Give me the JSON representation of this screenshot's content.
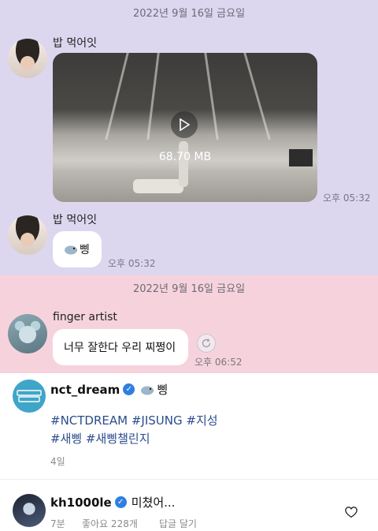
{
  "chat": {
    "date_header_1": "2022년 9월 16일 금요일",
    "msg1": {
      "sender": "밥 먹어잇",
      "video_size": "68.70 MB",
      "time": "오후 05:32"
    },
    "msg2": {
      "sender": "밥 먹어잇",
      "text": "삥",
      "time": "오후 05:32"
    },
    "date_header_2": "2022년 9월 16일 금요일",
    "msg3": {
      "sender": "finger artist",
      "text": "너무 잘한다 우리 찌쩡이",
      "time": "오후 06:52"
    }
  },
  "post_caption": {
    "username": "nct_dream",
    "text": "삥",
    "hashtags_line1": "#NCTDREAM #JISUNG #지성",
    "hashtags_line2": "#새삥 #새삥챌린지",
    "age": "4일"
  },
  "comment": {
    "username": "kh1000le",
    "text": "미쳤어...",
    "age": "7분",
    "likes": "좋아요 228개",
    "reply": "답글 달기"
  },
  "colors": {
    "chat_bg_1": "#ddd6ef",
    "chat_bg_2": "#f6d3dc",
    "hashtag": "#2b4c8c",
    "verified": "#2f7fe0"
  }
}
